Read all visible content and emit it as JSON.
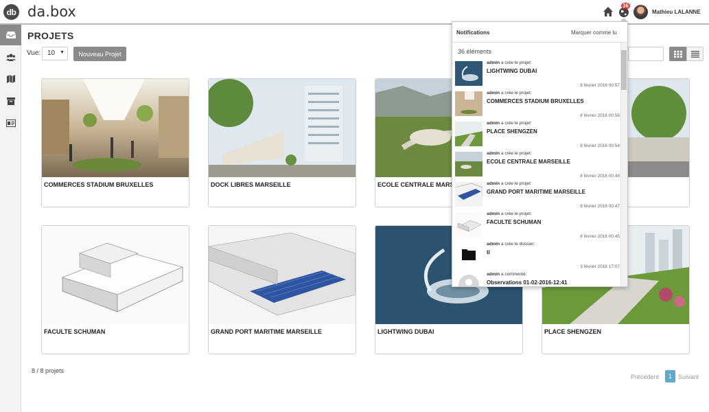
{
  "app": {
    "logo_initials": "db",
    "logo_text": "da.box"
  },
  "header": {
    "notif_badge": "36",
    "user_name": "Mathieu LALANNE"
  },
  "page": {
    "title": "PROJETS",
    "vue_label": "Vue:",
    "vue_value": "10",
    "new_button": "Nouveau Projet"
  },
  "projects": [
    {
      "name": "COMMERCES STADIUM BRUXELLES"
    },
    {
      "name": "DOCK LIBRES MARSEILLE"
    },
    {
      "name": "ECOLE CENTRALE MARSEILLE"
    },
    {
      "name": ""
    },
    {
      "name": "FACULTE SCHUMAN"
    },
    {
      "name": "GRAND PORT MARITIME MARSEILLE"
    },
    {
      "name": "LIGHTWING DUBAI"
    },
    {
      "name": "PLACE SHENGZEN"
    }
  ],
  "footer": {
    "count": "8 / 8 projets",
    "prev": "Précédent",
    "current": "1",
    "next": "Suivant"
  },
  "notifications": {
    "title": "Notifications",
    "mark_read": "Marquer comme lu",
    "count": "36 éléments",
    "items": [
      {
        "user": "admin",
        "action": " a crée le projet:",
        "target": "LIGHTWING DUBAI",
        "date": "8 février 2016 00:57"
      },
      {
        "user": "admin",
        "action": " a crée le projet:",
        "target": "COMMERCES STADIUM BRUXELLES",
        "date": "8 février 2016 00:56"
      },
      {
        "user": "admin",
        "action": " a crée le projet:",
        "target": "PLACE SHENGZEN",
        "date": "8 février 2016 00:54"
      },
      {
        "user": "admin",
        "action": " a crée le projet:",
        "target": "ECOLE CENTRALE MARSEILLE",
        "date": "8 février 2016 00:48"
      },
      {
        "user": "admin",
        "action": " a crée le projet:",
        "target": "GRAND PORT MARITIME MARSEILLE",
        "date": "8 février 2016 00:47"
      },
      {
        "user": "admin",
        "action": " a crée le projet:",
        "target": "FACULTE SCHUMAN",
        "date": "8 février 2016 00:45"
      },
      {
        "user": "admin",
        "action": " a crée le dossier:",
        "target": "ti",
        "date": "3 février 2016 17:07"
      },
      {
        "user": "admin",
        "action": " a commenté:",
        "target": "Observations  01-02-2016-12:41",
        "date": ""
      }
    ]
  },
  "icons": {
    "home": "home-icon",
    "bell": "globe-bell-icon",
    "sidebar": [
      "inbox-icon",
      "users-icon",
      "map-icon",
      "archive-icon",
      "id-card-icon"
    ]
  },
  "colors": {
    "accent": "#5fa7cc",
    "button": "#8a8a8a",
    "badge": "#d9312b"
  }
}
